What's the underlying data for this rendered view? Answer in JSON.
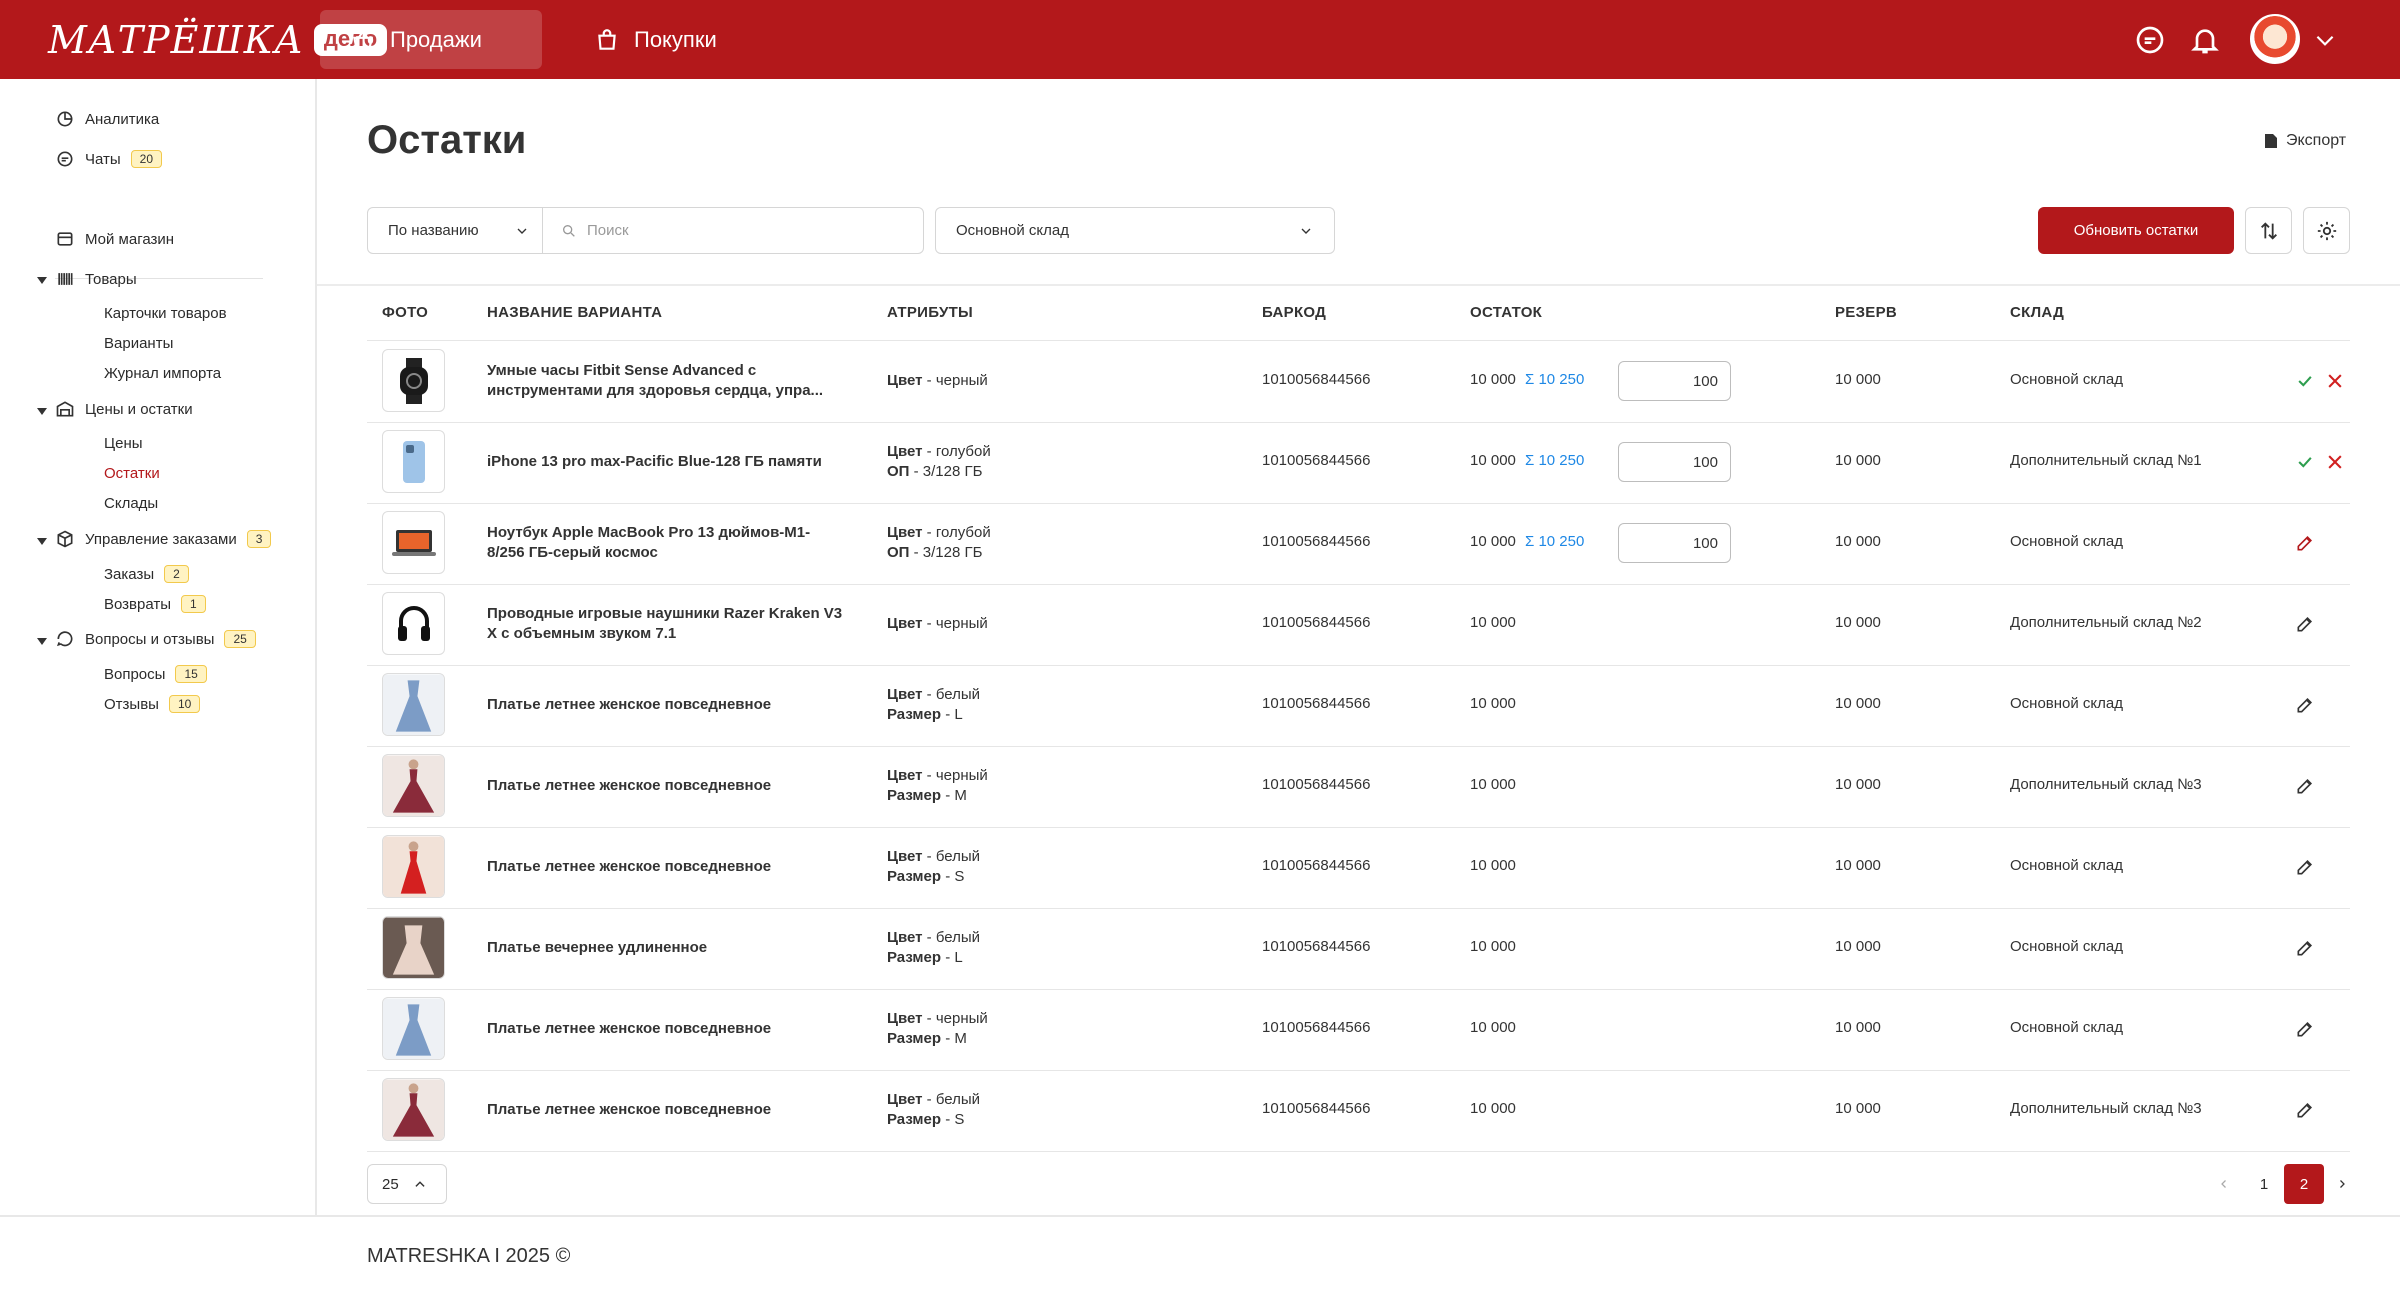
{
  "header": {
    "logo_text": "МАТРЁШКА",
    "logo_badge": "дело",
    "tabs": [
      {
        "label": "Продажи",
        "active": true
      },
      {
        "label": "Покупки",
        "active": false
      }
    ],
    "icons": [
      "chat-icon",
      "bell-icon",
      "avatar",
      "chevron-down-icon"
    ]
  },
  "sidebar": {
    "analytics": "Аналитика",
    "chats": "Чаты",
    "chats_count": "20",
    "my_shop": "Мой магазин",
    "goods": "Товары",
    "goods_items": [
      "Карточки товаров",
      "Варианты",
      "Журнал импорта"
    ],
    "prices": "Цены и остатки",
    "prices_items": [
      "Цены",
      "Остатки",
      "Склады"
    ],
    "orders": "Управление заказами",
    "orders_count": "3",
    "orders_items": [
      "Заказы",
      "Возвраты"
    ],
    "orders_items_counts": [
      "2",
      "1"
    ],
    "feedback": "Вопросы и отзывы",
    "feedback_count": "25",
    "feedback_items": [
      "Вопросы",
      "Отзывы"
    ],
    "feedback_items_counts": [
      "15",
      "10"
    ]
  },
  "page": {
    "title": "Остатки",
    "export": "Экспорт",
    "filter_mode": "По названию",
    "search_placeholder": "Поиск",
    "warehouse_select": "Основной склад",
    "update_button": "Обновить остатки"
  },
  "table": {
    "headers": [
      "ФОТО",
      "НАЗВАНИЕ ВАРИАНТА",
      "АТРИБУТЫ",
      "БАРКОД",
      "ОСТАТОК",
      "РЕЗЕРВ",
      "СКЛАД"
    ],
    "rows": [
      {
        "name": "Умные часы Fitbit Sense Advanced с инструментами для здоровья сердца, упра...",
        "attr1_k": "Цвет",
        "attr1_v": " - черный",
        "attr2_k": "",
        "attr2_v": "",
        "barcode": "1010056844566",
        "stock": "10 000",
        "sum": "10 250",
        "input": "100",
        "reserve": "10 000",
        "warehouse": "Основной склад",
        "mode": "confirm",
        "photo": "watch"
      },
      {
        "name": "iPhone 13 pro max-Pacific Blue-128 ГБ памяти",
        "attr1_k": "Цвет",
        "attr1_v": " - голубой",
        "attr2_k": "ОП",
        "attr2_v": " - 3/128 ГБ",
        "barcode": "1010056844566",
        "stock": "10 000",
        "sum": "10 250",
        "input": "100",
        "reserve": "10 000",
        "warehouse": "Дополнительный склад №1",
        "mode": "confirm",
        "photo": "phone"
      },
      {
        "name": "Ноутбук Apple MacBook Pro 13 дюймов-M1-8/256 ГБ-серый космос",
        "attr1_k": "Цвет",
        "attr1_v": " - голубой",
        "attr2_k": "ОП",
        "attr2_v": " - 3/128 ГБ",
        "barcode": "1010056844566",
        "stock": "10 000",
        "sum": "10 250",
        "input": "100",
        "reserve": "10 000",
        "warehouse": "Основной склад",
        "mode": "edit-active",
        "photo": "laptop"
      },
      {
        "name": "Проводные игровые наушники Razer Kraken V3 X с объемным звуком 7.1",
        "attr1_k": "Цвет",
        "attr1_v": " - черный",
        "attr2_k": "",
        "attr2_v": "",
        "barcode": "1010056844566",
        "stock": "10 000",
        "sum": "",
        "input": "",
        "reserve": "10 000",
        "warehouse": "Дополнительный склад №2",
        "mode": "edit",
        "photo": "headphones"
      },
      {
        "name": "Платье летнее женское повседневное",
        "attr1_k": "Цвет",
        "attr1_v": " - белый",
        "attr2_k": "Размер",
        "attr2_v": " - L",
        "barcode": "1010056844566",
        "stock": "10 000",
        "sum": "",
        "input": "",
        "reserve": "10 000",
        "warehouse": "Основной склад",
        "mode": "edit",
        "photo": "dress-blue"
      },
      {
        "name": "Платье летнее женское повседневное",
        "attr1_k": "Цвет",
        "attr1_v": " - черный",
        "attr2_k": "Размер",
        "attr2_v": " - M",
        "barcode": "1010056844566",
        "stock": "10 000",
        "sum": "",
        "input": "",
        "reserve": "10 000",
        "warehouse": "Дополнительный склад №3",
        "mode": "edit",
        "photo": "dress-maroon"
      },
      {
        "name": "Платье летнее женское повседневное",
        "attr1_k": "Цвет",
        "attr1_v": " - белый",
        "attr2_k": "Размер",
        "attr2_v": " - S",
        "barcode": "1010056844566",
        "stock": "10 000",
        "sum": "",
        "input": "",
        "reserve": "10 000",
        "warehouse": "Основной склад",
        "mode": "edit",
        "photo": "dress-red"
      },
      {
        "name": "Платье вечернее удлиненное",
        "attr1_k": "Цвет",
        "attr1_v": " - белый",
        "attr2_k": "Размер",
        "attr2_v": " - L",
        "barcode": "1010056844566",
        "stock": "10 000",
        "sum": "",
        "input": "",
        "reserve": "10 000",
        "warehouse": "Основной склад",
        "mode": "edit",
        "photo": "dress-beige"
      },
      {
        "name": "Платье летнее женское повседневное",
        "attr1_k": "Цвет",
        "attr1_v": " - черный",
        "attr2_k": "Размер",
        "attr2_v": " - M",
        "barcode": "1010056844566",
        "stock": "10 000",
        "sum": "",
        "input": "",
        "reserve": "10 000",
        "warehouse": "Основной склад",
        "mode": "edit",
        "photo": "dress-blue"
      },
      {
        "name": "Платье летнее женское повседневное",
        "attr1_k": "Цвет",
        "attr1_v": " - белый",
        "attr2_k": "Размер",
        "attr2_v": " - S",
        "barcode": "1010056844566",
        "stock": "10 000",
        "sum": "",
        "input": "",
        "reserve": "10 000",
        "warehouse": "Дополнительный склад №3",
        "mode": "edit",
        "photo": "dress-maroon"
      }
    ]
  },
  "pagination": {
    "per_page": "25",
    "pages": [
      "1",
      "2"
    ],
    "current": "2"
  },
  "footer": {
    "text": "MATRESHKA I 2025 ©"
  },
  "colors": {
    "brand": "#b3181b",
    "accent_blue": "#1e88e5",
    "confirm_green": "#2e9e4f",
    "badge_yellow": "#fff3c2"
  }
}
